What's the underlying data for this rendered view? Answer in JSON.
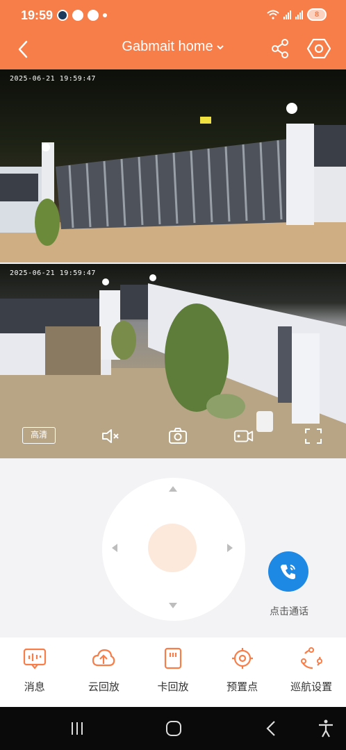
{
  "status_bar": {
    "time": "19:59",
    "battery": "8"
  },
  "header": {
    "title": "Gabmait home"
  },
  "cameras": [
    {
      "timestamp": "2025-06-21 19:59:47"
    },
    {
      "timestamp": "2025-06-21 19:59:47"
    }
  ],
  "camera_controls": {
    "quality_label": "高清"
  },
  "call": {
    "label": "点击通话"
  },
  "tabs": [
    {
      "label": "消息",
      "icon": "message-icon"
    },
    {
      "label": "云回放",
      "icon": "cloud-upload-icon"
    },
    {
      "label": "卡回放",
      "icon": "sd-card-icon"
    },
    {
      "label": "预置点",
      "icon": "target-icon"
    },
    {
      "label": "巡航设置",
      "icon": "cruise-icon"
    }
  ],
  "colors": {
    "accent": "#f77d49",
    "call": "#1e88e5",
    "tab_icon": "#f77d49"
  }
}
